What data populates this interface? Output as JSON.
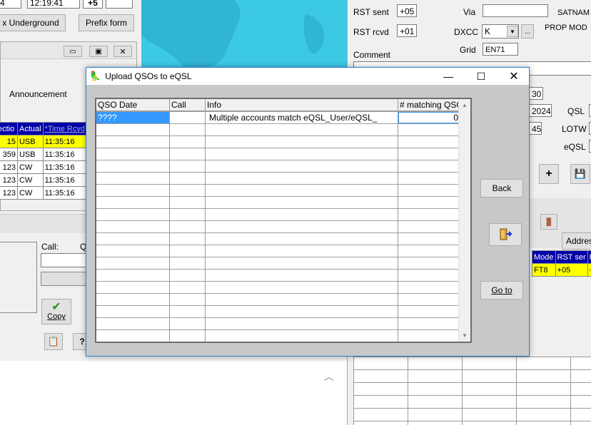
{
  "left_panel": {
    "row_partial_value": "4",
    "time_value": "12:19:41",
    "offset_value": "+5",
    "buttons": {
      "underground": "x Underground",
      "prefix": "Prefix form",
      "announcement": "Announcement",
      "copy": "Copy"
    },
    "call_label": "Call:",
    "q_label": "Q",
    "table_headers": [
      "ectio",
      "Actual",
      "*Time Rcvd"
    ],
    "table_rows": [
      [
        "15",
        "USB",
        "11:35:16"
      ],
      [
        "359",
        "USB",
        "11:35:16"
      ],
      [
        "123",
        "CW",
        "11:35:16"
      ],
      [
        "123",
        "CW",
        "11:35:16"
      ],
      [
        "123",
        "CW",
        "11:35:16"
      ]
    ]
  },
  "right_panel": {
    "rst_sent_label": "RST sent",
    "rst_sent_value": "+05",
    "rst_rcvd_label": "RST rcvd",
    "rst_rcvd_value": "+01",
    "via_label": "Via",
    "dxcc_label": "DXCC",
    "dxcc_value": "K",
    "grid_label": "Grid",
    "grid_value": "EN71",
    "comment_label": "Comment",
    "satname_label": "SATNAM",
    "prop_mode_label": "PROP MOD",
    "day_value": "30",
    "year_value": "2024",
    "min_value": "45",
    "qsl_label": "QSL",
    "lotw_label": "LOTW",
    "eqsl_label": "eQSL",
    "address_label": "Addres",
    "table_headers": [
      "Mode",
      "RST ser",
      "R"
    ],
    "table_row": [
      "FT8",
      "+05",
      "+"
    ]
  },
  "dialog": {
    "title": "Upload QSOs to eQSL",
    "columns": [
      "QSO Date",
      "Call",
      "Info",
      "# matching QSO"
    ],
    "rows": [
      {
        "date": "????",
        "call": "",
        "info": "Multiple accounts match eQSL_User/eQSL_",
        "matching": "0"
      }
    ],
    "back_label": "Back",
    "goto_label": "Go to"
  },
  "colors": {
    "accent": "#2a7fd4",
    "selection": "#3399ff",
    "highlight": "#ffff00",
    "header_blue": "#0000a8"
  }
}
